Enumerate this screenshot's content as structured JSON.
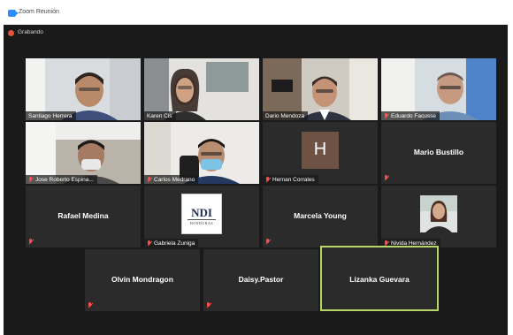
{
  "window": {
    "title": "Zoom Reunión",
    "recording_label": "Grabando"
  },
  "participants": [
    {
      "name": "Santiago Herrera",
      "muted": false
    },
    {
      "name": "Karen Cis",
      "muted": false
    },
    {
      "name": "Dario Mendoza",
      "muted": false
    },
    {
      "name": "Eduardo Facusse",
      "muted": true
    },
    {
      "name": "Jose Roberto Espina...",
      "muted": true
    },
    {
      "name": "Carlos Medrano",
      "muted": true
    },
    {
      "name": "Hernan Corrales",
      "muted": true,
      "avatar_letter": "H"
    },
    {
      "name": "Mario Bustillo",
      "muted": true
    },
    {
      "name": "Rafael Medina",
      "muted": true
    },
    {
      "name": "Gabriela Zuniga",
      "muted": true,
      "logo_text": "NDI",
      "logo_subtext": "HONDURAS"
    },
    {
      "name": "Marcela Young",
      "muted": true
    },
    {
      "name": "Nivida Hernández",
      "muted": true
    },
    {
      "name": "Olvin Mondragon",
      "muted": true
    },
    {
      "name": "Daisy.Pastor",
      "muted": true
    },
    {
      "name": "Lizanka Guevara",
      "muted": false,
      "active_speaker": true
    }
  ],
  "colors": {
    "background": "#1a1a1a",
    "tile": "#2b2b2b",
    "active_border": "#b6d66a",
    "muted_icon": "#ff4d4d",
    "brand": "#2d8cff"
  },
  "icons": [
    "zoom-logo-icon",
    "recording-icon",
    "muted-mic-icon"
  ]
}
